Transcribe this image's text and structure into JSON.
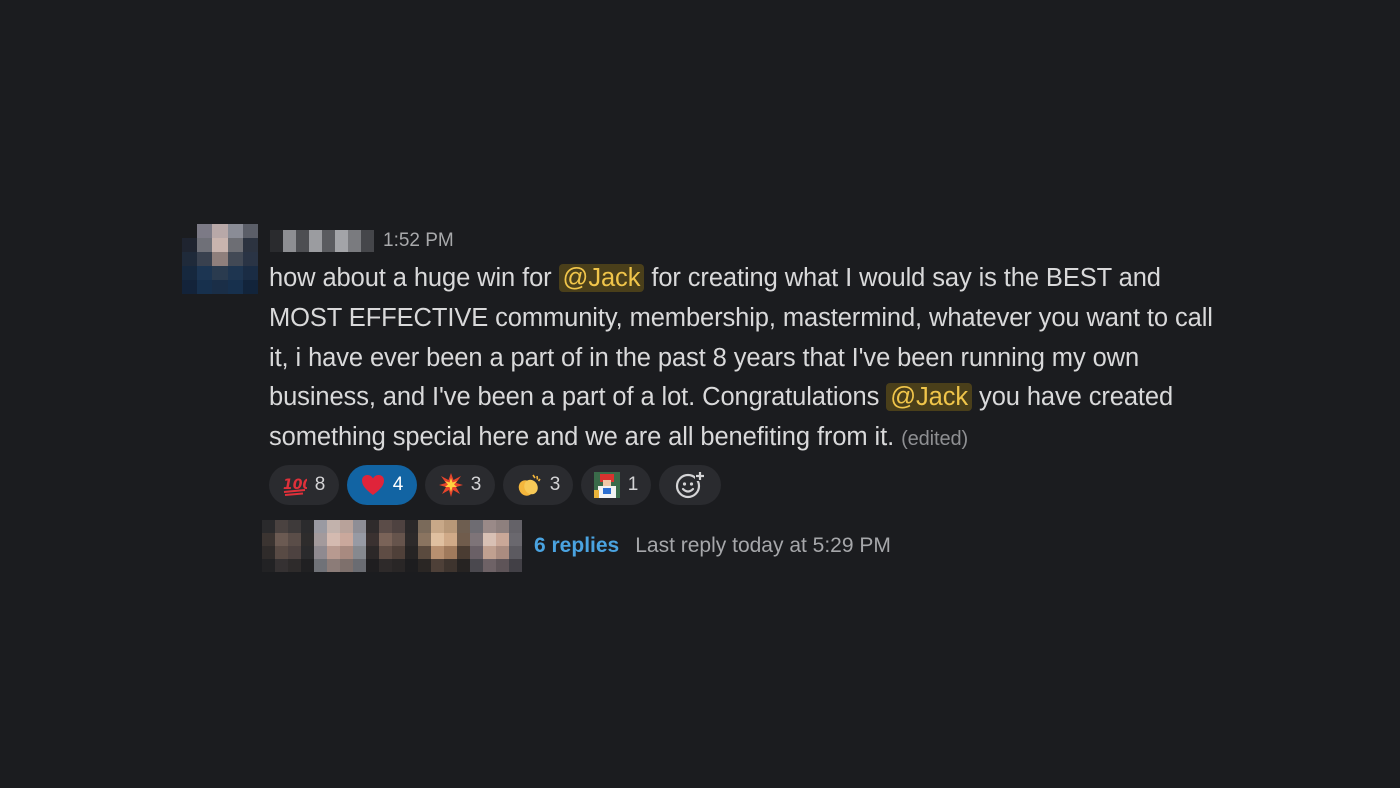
{
  "message": {
    "timestamp": "1:52 PM",
    "lines": {
      "l1_a": "how about a huge win for ",
      "mention1": "@Jack",
      "l1_b": " for creating what I would say is the BEST and MOST EFFECTIVE community, membership, mastermind, whatever you want to call it, i have ever been a part of in the past 8 years that I've been running my own business, and I've been a part of a lot. Congratulations ",
      "mention2": "@Jack",
      "l1_c": " you have created something special here and we are all benefiting from it. ",
      "edited": "(edited)"
    }
  },
  "reactions": [
    {
      "emoji": "💯",
      "icon": "hundred-points-icon",
      "count": "8",
      "active": false
    },
    {
      "emoji": "❤️",
      "icon": "heart-icon",
      "count": "4",
      "active": true
    },
    {
      "emoji": "💥",
      "icon": "collision-icon",
      "count": "3",
      "active": false
    },
    {
      "emoji": "👏",
      "icon": "clapping-hands-icon",
      "count": "3",
      "active": false
    },
    {
      "emoji": "🎁",
      "icon": "custom-emoji-icon",
      "count": "1",
      "active": false
    }
  ],
  "thread": {
    "replies": "6 replies",
    "last_reply": "Last reply today at 5:29 PM"
  },
  "colors": {
    "background": "#1b1c1f",
    "mention_bg": "#4a3f1a",
    "mention_fg": "#f0c54a",
    "active_reaction": "#1264a3",
    "link": "#4aa3e0"
  }
}
